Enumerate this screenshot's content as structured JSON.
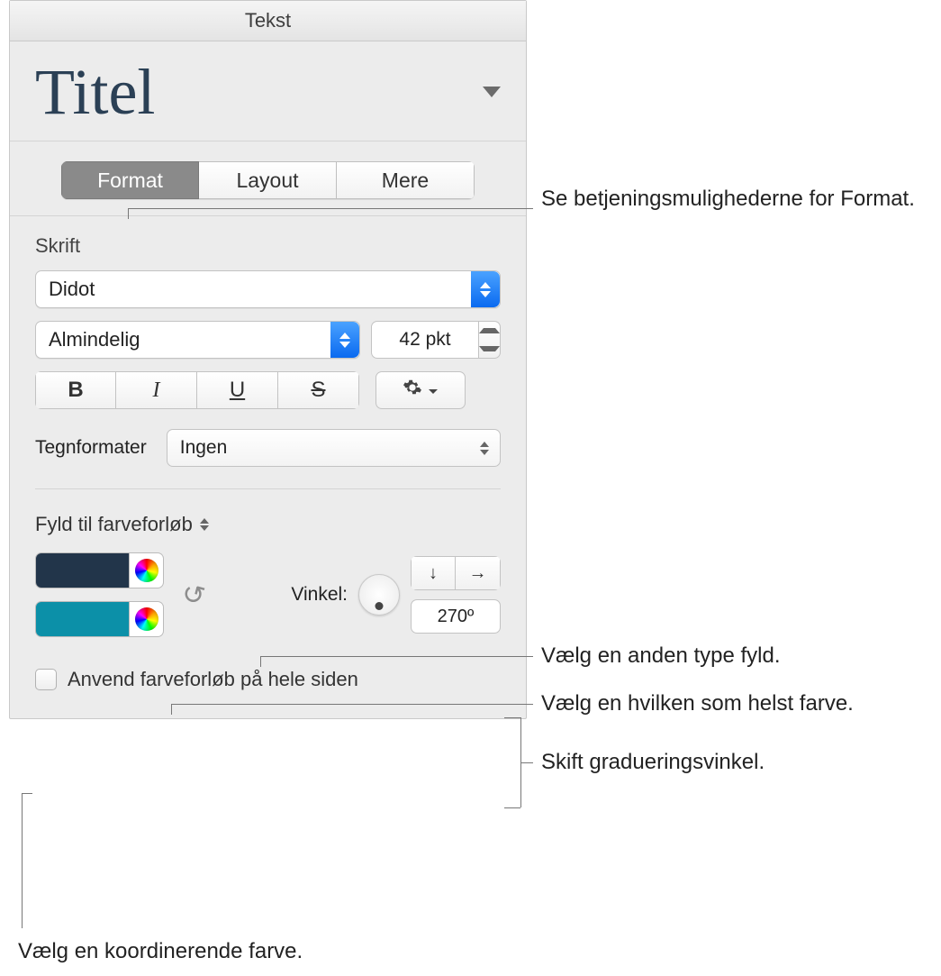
{
  "header": {
    "title": "Tekst"
  },
  "title": {
    "label": "Titel"
  },
  "tabs": {
    "format": "Format",
    "layout": "Layout",
    "more": "Mere"
  },
  "font": {
    "label": "Skrift",
    "family": "Didot",
    "weight": "Almindelig",
    "size": "42 pkt",
    "bold": "B",
    "italic": "I",
    "underline": "U",
    "strike": "S"
  },
  "charstyles": {
    "label": "Tegnformater",
    "value": "Ingen"
  },
  "fill": {
    "label": "Fyld til farveforløb",
    "color1": "#22354a",
    "color2": "#0c90a8",
    "angle_label": "Vinkel:",
    "angle_value": "270º",
    "apply_all": "Anvend farveforløb på hele siden"
  },
  "callouts": {
    "format": "Se betjeningsmulighederne for Format.",
    "fill_type": "Vælg en anden type fyld.",
    "any_color": "Vælg en hvilken som helst farve.",
    "angle": "Skift gradueringsvinkel.",
    "coord_color": "Vælg en koordinerende farve."
  }
}
